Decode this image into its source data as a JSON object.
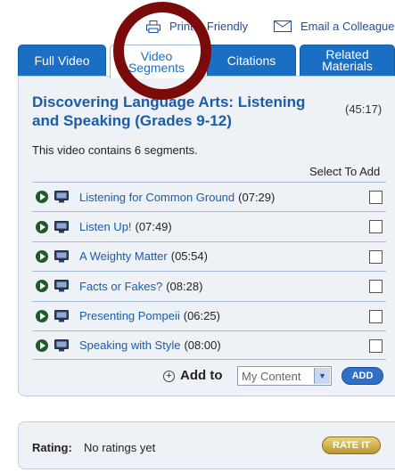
{
  "utility": {
    "print_label": "Printer Friendly",
    "email_label": "Email a Colleague"
  },
  "tabs": [
    {
      "line1": "Full Video",
      "line2": ""
    },
    {
      "line1": "Video",
      "line2": "Segments"
    },
    {
      "line1": "Citations",
      "line2": ""
    },
    {
      "line1": "Related",
      "line2": "Materials"
    }
  ],
  "main": {
    "title": "Discovering Language Arts: Listening and Speaking (Grades 9-12)",
    "duration": "(45:17)",
    "info": "This video contains 6 segments.",
    "select_header": "Select To Add",
    "segments": [
      {
        "title": "Listening for Common Ground",
        "time": "(07:29)",
        "checked": false
      },
      {
        "title": "Listen Up!",
        "time": "(07:49)",
        "checked": false
      },
      {
        "title": "A Weighty Matter",
        "time": "(05:54)",
        "checked": false
      },
      {
        "title": "Facts or Fakes?",
        "time": "(08:28)",
        "checked": false
      },
      {
        "title": "Presenting Pompeii",
        "time": "(06:25)",
        "checked": false
      },
      {
        "title": "Speaking with Style",
        "time": "(08:00)",
        "checked": false
      }
    ],
    "add_to_label": "Add to",
    "add_to_selected": "My Content",
    "add_button": "ADD"
  },
  "rating": {
    "label": "Rating:",
    "value": "No ratings yet",
    "button": "RATE IT"
  },
  "colors": {
    "tab_blue": "#1a6fc4",
    "link_blue": "#1b5ca8",
    "annotation_red": "#7b0b0b",
    "panel_bg": "#eef2f7"
  },
  "icons": [
    "printer-icon",
    "envelope-icon",
    "play-icon",
    "monitor-icon",
    "plus-circle-icon",
    "dropdown-arrow-icon"
  ]
}
